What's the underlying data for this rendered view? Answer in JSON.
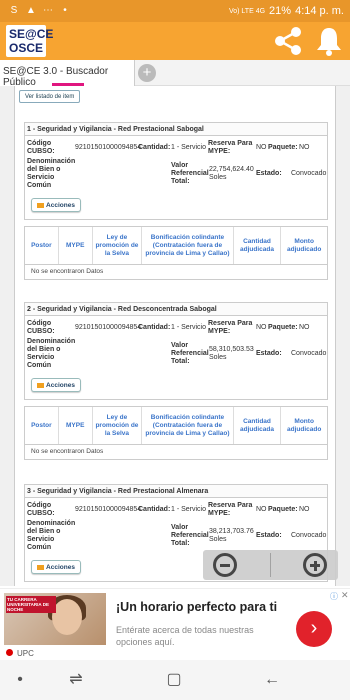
{
  "status": {
    "left_icons": [
      "S",
      "▲",
      "⋯",
      "•"
    ],
    "battery": "21%",
    "time": "4:14 p. m.",
    "network": "Vo) LTE 4G"
  },
  "app": {
    "logo_top": "SE@CE",
    "logo_bottom": "OSCE"
  },
  "tab": {
    "label": "SE@CE 3.0 - Buscador Público"
  },
  "content": {
    "ver_listado": "Ver listado de item",
    "sections": [
      {
        "title": "1 - Seguridad y Vigilancia - Red Prestacional Sabogal",
        "codigo_label": "Código CUBSO:",
        "codigo": "92101501000094854",
        "cantidad_label": "Cantidad:",
        "cantidad": "1 - Servicio",
        "reserva_label": "Reserva Para MYPE:",
        "reserva": "NO",
        "paquete_label": "Paquete:",
        "paquete": "NO",
        "denom_label": "Denominación del Bien o Servicio Común",
        "valor_label": "Valor Referencial Total:",
        "valor": "22,754,624.40 Soles",
        "estado_label": "Estado:",
        "estado": "Convocado",
        "acciones": "Acciones"
      },
      {
        "title": "2 - Seguridad y Vigilancia - Red Desconcentrada Sabogal",
        "codigo_label": "Código CUBSO:",
        "codigo": "92101501000094854",
        "cantidad_label": "Cantidad:",
        "cantidad": "1 - Servicio",
        "reserva_label": "Reserva Para MYPE:",
        "reserva": "NO",
        "paquete_label": "Paquete:",
        "paquete": "NO",
        "denom_label": "Denominación del Bien o Servicio Común",
        "valor_label": "Valor Referencial Total:",
        "valor": "58,310,503.53 Soles",
        "estado_label": "Estado:",
        "estado": "Convocado",
        "acciones": "Acciones"
      },
      {
        "title": "3 - Seguridad y Vigilancia - Red Prestacional Almenara",
        "codigo_label": "Código CUBSO:",
        "codigo": "92101501000094854",
        "cantidad_label": "Cantidad:",
        "cantidad": "1 - Servicio",
        "reserva_label": "Reserva Para MYPE:",
        "reserva": "NO",
        "paquete_label": "Paquete:",
        "paquete": "NO",
        "denom_label": "Denominación del Bien o Servicio Común",
        "valor_label": "Valor Referencial Total:",
        "valor": "38,213,703.76 Soles",
        "estado_label": "Estado:",
        "estado": "Convocado",
        "acciones": "Acciones"
      }
    ],
    "table": {
      "headers": [
        "Postor",
        "MYPE",
        "Ley de promoción de la Selva",
        "Bonificación colindante (Contratación fuera de provincia de Lima y Callao)",
        "Cantidad adjudicada",
        "Monto adjudicado"
      ],
      "no_results": "No se encontraron Datos"
    }
  },
  "ad": {
    "image_text": "TU CARRERA UNIVERSITARIA DE NOCHE",
    "title": "¡Un horario perfecto para ti",
    "subtitle": "Entérate acerca de todas nuestras opciones aquí.",
    "brand": "UPC",
    "arrow": "›",
    "info": "ⓘ",
    "close": "✕"
  },
  "nav": {
    "dot": "•",
    "recent": "⇌",
    "home": "▢",
    "back": "←"
  }
}
